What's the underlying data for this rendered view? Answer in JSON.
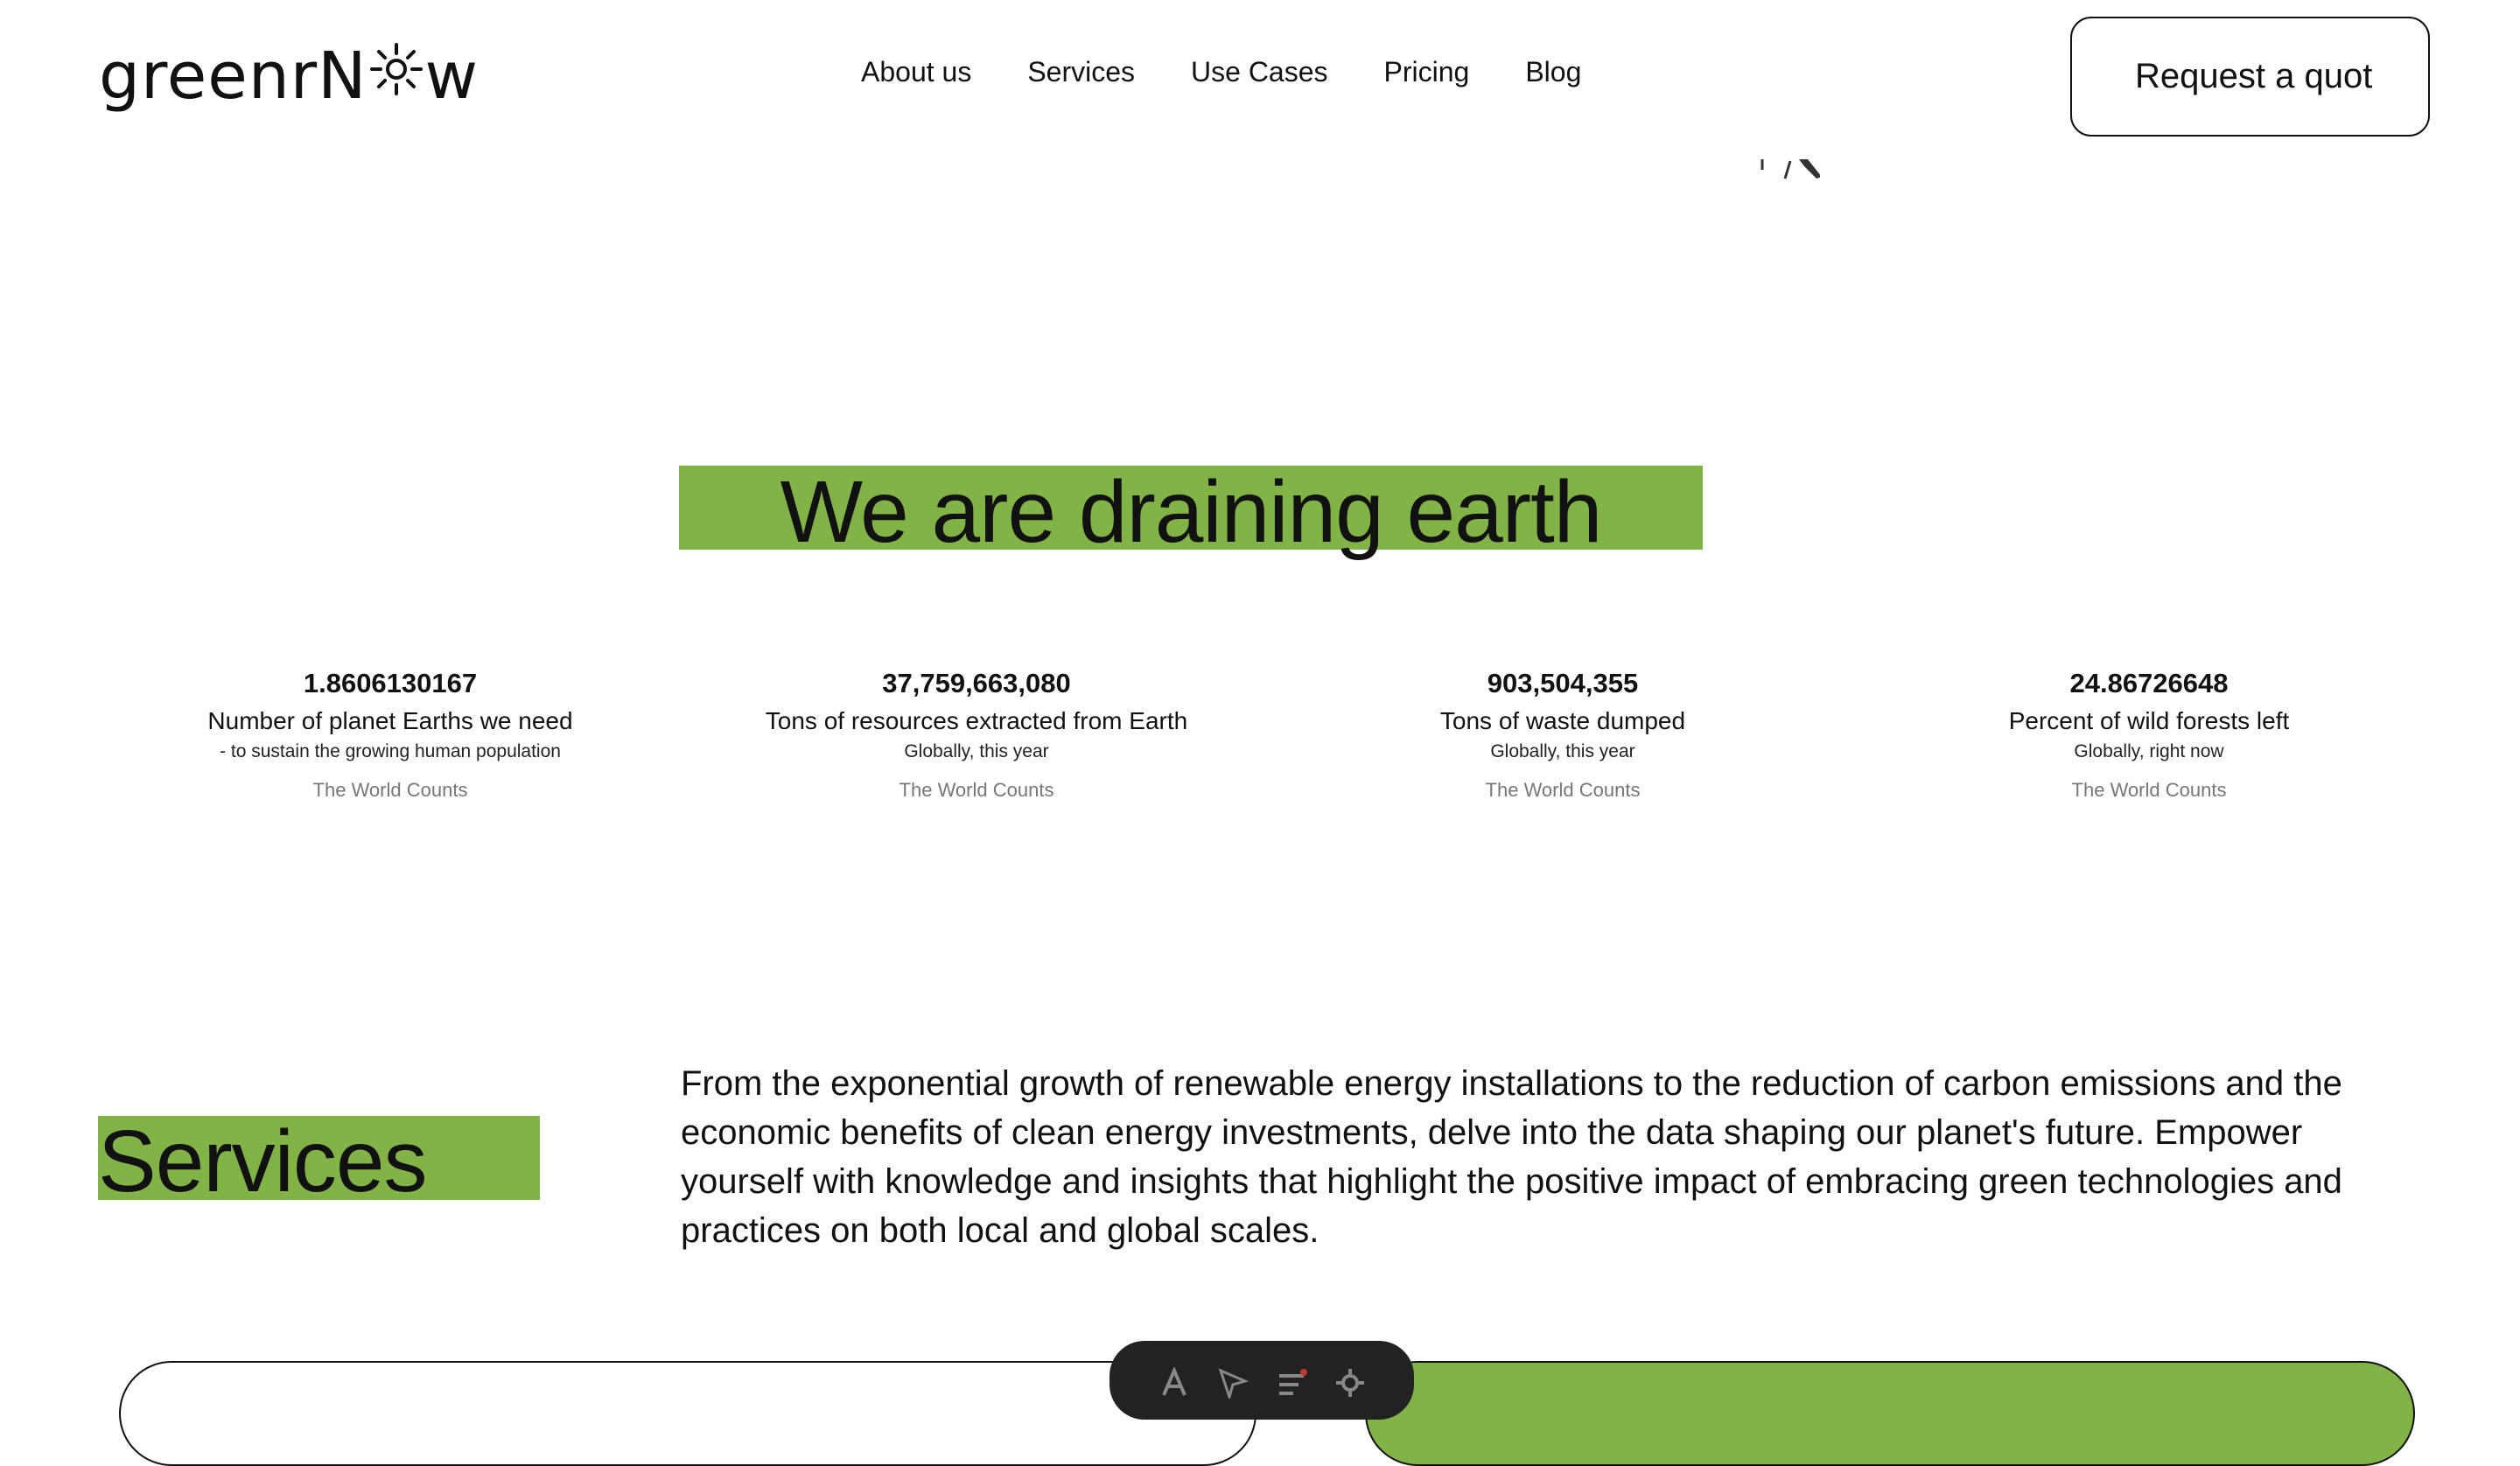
{
  "header": {
    "logo_text_left": "greenrN",
    "logo_text_right": "w",
    "nav_items": [
      {
        "label": "About us"
      },
      {
        "label": "Services"
      },
      {
        "label": "Use Cases"
      },
      {
        "label": "Pricing"
      },
      {
        "label": "Blog"
      }
    ],
    "quote_button_label": "Request a quot"
  },
  "hero": {
    "headline": "We are draining earth"
  },
  "stats": [
    {
      "value": "1.8606130167",
      "label": "Number of planet Earths we need",
      "sub": "- to sustain the growing human population",
      "source": "The World Counts"
    },
    {
      "value": "37,759,663,080",
      "label": "Tons of resources extracted from Earth",
      "sub": "Globally, this year",
      "source": "The World Counts"
    },
    {
      "value": "903,504,355",
      "label": "Tons of waste dumped",
      "sub": "Globally, this year",
      "source": "The World Counts"
    },
    {
      "value": "24.86726648",
      "label": "Percent of wild forests left",
      "sub": "Globally, right now",
      "source": "The World Counts"
    }
  ],
  "services": {
    "title": "Services",
    "description": "From the exponential growth of renewable energy installations to the reduction of carbon emissions and the economic benefits of clean energy investments, delve into the data shaping our planet's future. Empower yourself with knowledge and insights that highlight the positive impact of embracing green technologies and practices on both local and global scales."
  },
  "colors": {
    "accent_green": "#81b346",
    "text": "#111111",
    "muted": "#777777",
    "toolbar_bg": "#222222"
  },
  "icons": {
    "logo_o": "sun-icon",
    "toolbar": [
      "text-tool-icon",
      "pointer-tool-icon",
      "menu-tool-icon",
      "settings-tool-icon"
    ]
  }
}
